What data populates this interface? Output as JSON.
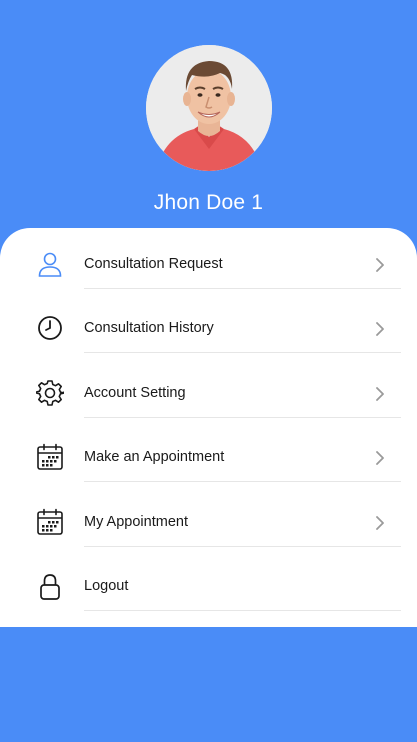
{
  "profile": {
    "name": "Jhon Doe 1"
  },
  "colors": {
    "background": "#4a8cf7",
    "card": "#ffffff",
    "accent_icon": "#4a8cf7",
    "text": "#1a1a1a"
  },
  "menu": {
    "items": [
      {
        "label": "Consultation Request",
        "icon": "user-icon",
        "has_chevron": true
      },
      {
        "label": "Consultation History",
        "icon": "clock-icon",
        "has_chevron": true
      },
      {
        "label": "Account Setting",
        "icon": "gear-icon",
        "has_chevron": true
      },
      {
        "label": "Make an Appointment",
        "icon": "calendar-icon",
        "has_chevron": true
      },
      {
        "label": "My Appointment",
        "icon": "calendar-icon",
        "has_chevron": true
      },
      {
        "label": "Logout",
        "icon": "lock-icon",
        "has_chevron": false
      }
    ]
  }
}
